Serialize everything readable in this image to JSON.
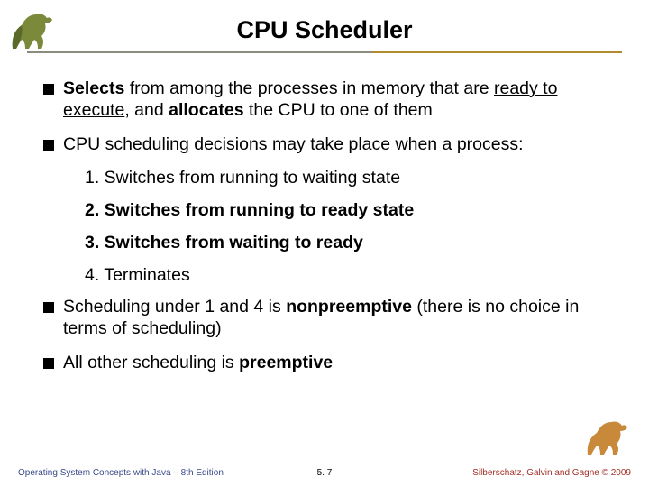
{
  "title": "CPU Scheduler",
  "bullets": {
    "b1": {
      "pre": "Selects",
      "mid1": " from among the processes in memory that are ",
      "u": "ready to execute",
      "mid2": ", and ",
      "b2": "allocates",
      "post": " the CPU to one of them"
    },
    "b2": "CPU scheduling decisions may take place when a process:",
    "n1": "1. Switches from running to waiting state",
    "n2": "2. Switches from running to ready state",
    "n3": "3. Switches from waiting to ready",
    "n4": "4. Terminates",
    "b3": {
      "pre": "Scheduling under 1 and 4 is ",
      "bold": "nonpreemptive",
      "post": " (there is no choice in terms of scheduling)"
    },
    "b4": {
      "pre": "All other scheduling is ",
      "bold": "preemptive"
    }
  },
  "footer": {
    "left": "Operating System Concepts with Java – 8th Edition",
    "mid": "5. 7",
    "right": "Silberschatz, Galvin and Gagne © 2009"
  }
}
